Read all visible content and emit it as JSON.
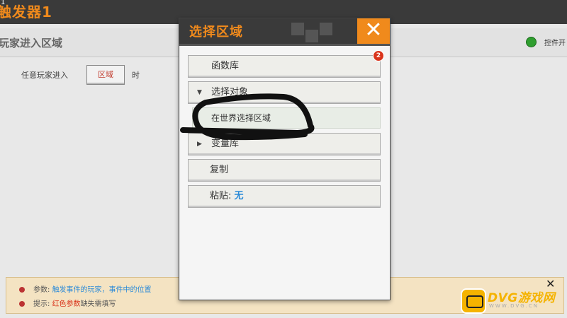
{
  "corner_number": "1",
  "window": {
    "title": "触发器1"
  },
  "section": {
    "title": "玩家进入区域",
    "toggle_label": "控件开"
  },
  "condition": {
    "prefix": "任意玩家进入",
    "region_button": "区域",
    "suffix": "时"
  },
  "hints": {
    "params_label": "参数:",
    "params_value": "触发事件的玩家，事件中的位置",
    "tip_label": "提示:",
    "tip_red": "红色参数",
    "tip_rest": "缺失需填写",
    "close_glyph": "✕"
  },
  "dialog": {
    "title": "选择区域",
    "close_glyph": "✕",
    "items": [
      {
        "label": "函数库",
        "badge": "2"
      },
      {
        "label": "选择对象",
        "arrow": "▼"
      },
      {
        "label": "在世界选择区域"
      },
      {
        "label": "变量库",
        "arrow": "▶"
      },
      {
        "label": "复制"
      },
      {
        "label": "粘贴:",
        "value": "无"
      }
    ]
  },
  "watermark": {
    "title": "DVG游戏网",
    "subtitle": "WWW.DVG.CN"
  },
  "colors": {
    "accent": "#f08a1c",
    "dark_bar": "#3a3a3a",
    "link_blue": "#2a8ad8",
    "alert_red": "#d9341c",
    "scribble": "#111111"
  }
}
